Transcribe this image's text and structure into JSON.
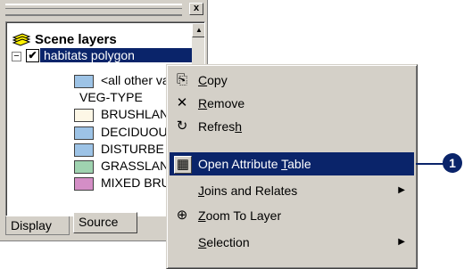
{
  "toc": {
    "title_close": "x",
    "scene_layers_label": "Scene layers",
    "expander": "−",
    "checkbox": "✔",
    "layer_name": "habitats polygon",
    "items": [
      {
        "label": "<all other va",
        "color": "#9dc3e6"
      },
      {
        "label": "VEG-TYPE",
        "color": ""
      },
      {
        "label": "BRUSHLAN",
        "color": "#fdf7e6"
      },
      {
        "label": "DECIDUOU",
        "color": "#9dc3e6"
      },
      {
        "label": "DISTURBE",
        "color": "#9dc3e6"
      },
      {
        "label": "GRASSLAN",
        "color": "#9fd3b0"
      },
      {
        "label": "MIXED BRU",
        "color": "#d48ec6"
      }
    ],
    "tabs": [
      "Display",
      "Source"
    ]
  },
  "context_menu": {
    "items": [
      {
        "icon": "copy-icon",
        "glyph": "⎘",
        "label_pre": "",
        "label_u": "C",
        "label_post": "opy",
        "submenu": false
      },
      {
        "icon": "remove-icon",
        "glyph": "✕",
        "label_pre": "",
        "label_u": "R",
        "label_post": "emove",
        "submenu": false
      },
      {
        "icon": "refresh-icon",
        "glyph": "↻",
        "label_pre": "Refres",
        "label_u": "h",
        "label_post": "",
        "submenu": false
      },
      {
        "icon": "attribute-table-icon",
        "glyph": "▦",
        "label_pre": "Open Attribute ",
        "label_u": "T",
        "label_post": "able",
        "submenu": false,
        "highlighted": true
      },
      {
        "icon": "",
        "glyph": "",
        "label_pre": "",
        "label_u": "J",
        "label_post": "oins and Relates",
        "submenu": true
      },
      {
        "icon": "zoom-to-layer-icon",
        "glyph": "⊕",
        "label_pre": "",
        "label_u": "Z",
        "label_post": "oom To Layer",
        "submenu": false
      },
      {
        "icon": "",
        "glyph": "",
        "label_pre": "",
        "label_u": "S",
        "label_post": "election",
        "submenu": true
      }
    ]
  },
  "callout": {
    "number": "1"
  },
  "colors": {
    "highlight": "#0a246a",
    "chrome": "#d4d0c8"
  }
}
